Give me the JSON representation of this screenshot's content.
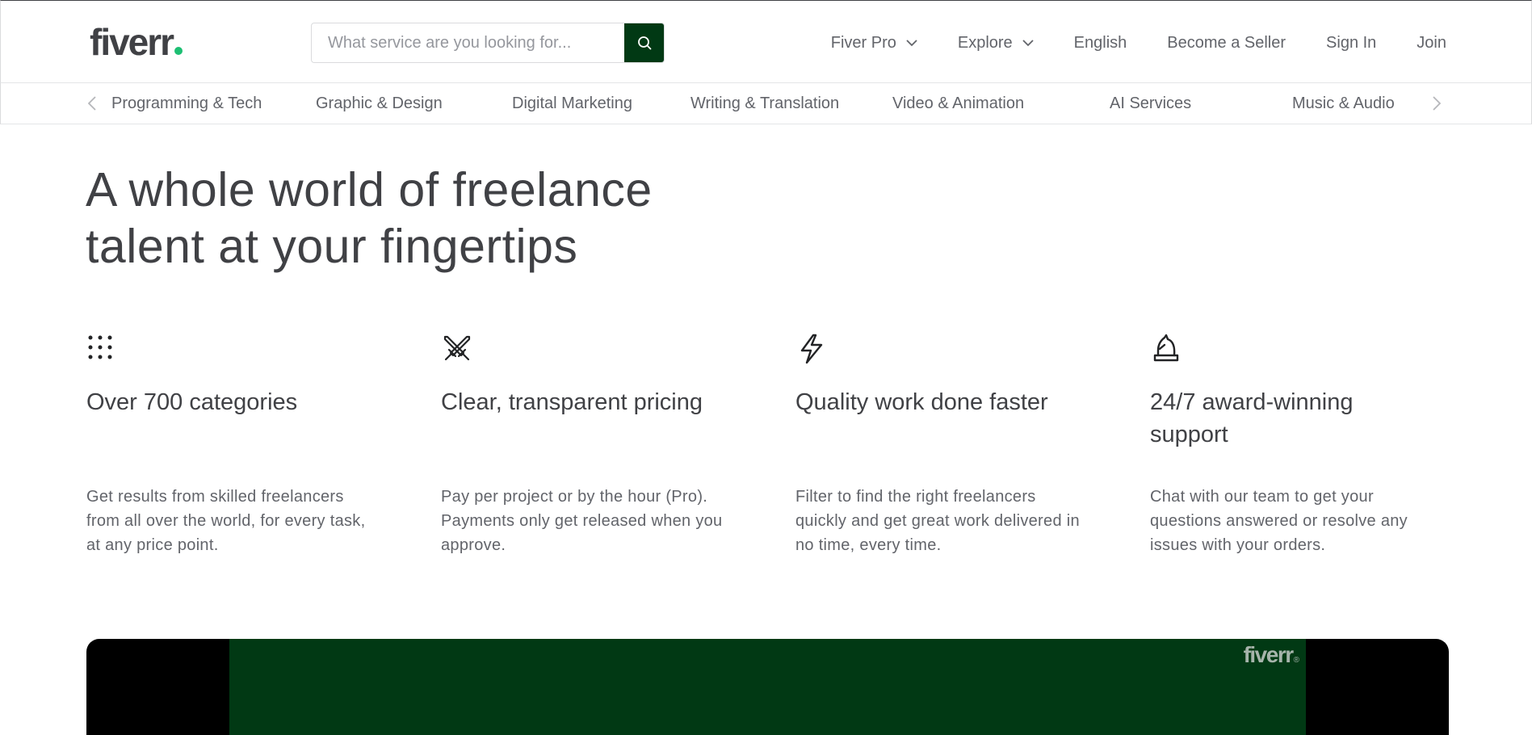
{
  "header": {
    "logo_text": "fiverr",
    "search_placeholder": "What service are you looking for...",
    "nav": {
      "fiverr_pro": "Fiver Pro",
      "explore": "Explore",
      "language": "English",
      "become_seller": "Become a Seller",
      "sign_in": "Sign In",
      "join": "Join"
    }
  },
  "categories": [
    "Programming & Tech",
    "Graphic & Design",
    "Digital Marketing",
    "Writing & Translation",
    "Video & Animation",
    "AI Services",
    "Music & Audio"
  ],
  "hero": {
    "title_line1": "A whole world of freelance",
    "title_line2": "talent at your fingertips"
  },
  "features": [
    {
      "icon": "grid-dots-icon",
      "title": "Over 700 categories",
      "desc_lines": [
        "Get results from skilled freelancers",
        "from all over the world, for every task,",
        "at any price point."
      ]
    },
    {
      "icon": "crossed-swords-icon",
      "title": "Clear, transparent pricing",
      "desc_lines": [
        "Pay per project or by the hour (Pro).",
        "Payments only get released when you",
        "approve."
      ]
    },
    {
      "icon": "lightning-bolt-icon",
      "title": "Quality work done faster",
      "desc_lines": [
        "Filter to find the right freelancers",
        "quickly and get great work delivered in",
        "no time, every time."
      ]
    },
    {
      "icon": "chess-knight-icon",
      "title_lines": [
        "24/7 award-winning",
        "support"
      ],
      "desc_lines": [
        "Chat with our team to get your",
        "questions answered or resolve any",
        "issues with your orders."
      ]
    }
  ],
  "banner": {
    "logo_text": "fiverr",
    "logo_mark": "®"
  },
  "colors": {
    "brand_green": "#1dbf73",
    "dark_green": "#013914",
    "text": "#404145",
    "muted": "#62646a"
  }
}
